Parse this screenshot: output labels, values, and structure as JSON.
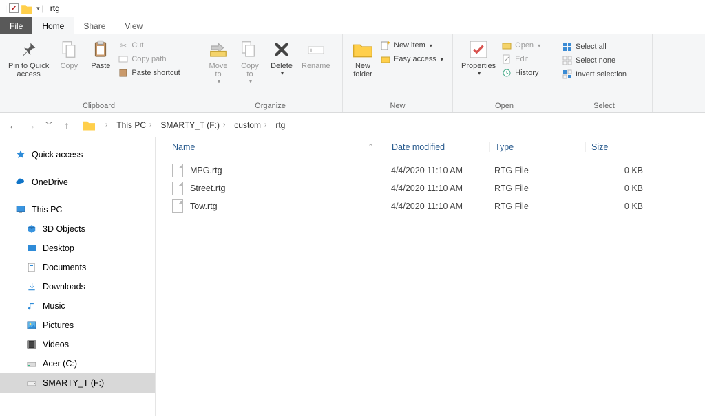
{
  "window": {
    "title": "rtg"
  },
  "tabs": {
    "file": "File",
    "home": "Home",
    "share": "Share",
    "view": "View"
  },
  "ribbon": {
    "clipboard": {
      "label": "Clipboard",
      "pin": "Pin to Quick\naccess",
      "copy": "Copy",
      "paste": "Paste",
      "cut": "Cut",
      "copypath": "Copy path",
      "pasteshortcut": "Paste shortcut"
    },
    "organize": {
      "label": "Organize",
      "moveto": "Move\nto",
      "copyto": "Copy\nto",
      "delete": "Delete",
      "rename": "Rename"
    },
    "new": {
      "label": "New",
      "newfolder": "New\nfolder",
      "newitem": "New item",
      "easyaccess": "Easy access"
    },
    "open": {
      "label": "Open",
      "properties": "Properties",
      "open": "Open",
      "edit": "Edit",
      "history": "History"
    },
    "select": {
      "label": "Select",
      "selectall": "Select all",
      "selectnone": "Select none",
      "invert": "Invert selection"
    }
  },
  "breadcrumb": [
    "This PC",
    "SMARTY_T (F:)",
    "custom",
    "rtg"
  ],
  "columns": {
    "name": "Name",
    "date": "Date modified",
    "type": "Type",
    "size": "Size"
  },
  "navpane": {
    "quickaccess": "Quick access",
    "onedrive": "OneDrive",
    "thispc": "This PC",
    "items": [
      {
        "label": "3D Objects"
      },
      {
        "label": "Desktop"
      },
      {
        "label": "Documents"
      },
      {
        "label": "Downloads"
      },
      {
        "label": "Music"
      },
      {
        "label": "Pictures"
      },
      {
        "label": "Videos"
      },
      {
        "label": "Acer (C:)"
      },
      {
        "label": "SMARTY_T (F:)"
      }
    ]
  },
  "files": [
    {
      "name": "MPG.rtg",
      "date": "4/4/2020 11:10 AM",
      "type": "RTG File",
      "size": "0 KB"
    },
    {
      "name": "Street.rtg",
      "date": "4/4/2020 11:10 AM",
      "type": "RTG File",
      "size": "0 KB"
    },
    {
      "name": "Tow.rtg",
      "date": "4/4/2020 11:10 AM",
      "type": "RTG File",
      "size": "0 KB"
    }
  ]
}
